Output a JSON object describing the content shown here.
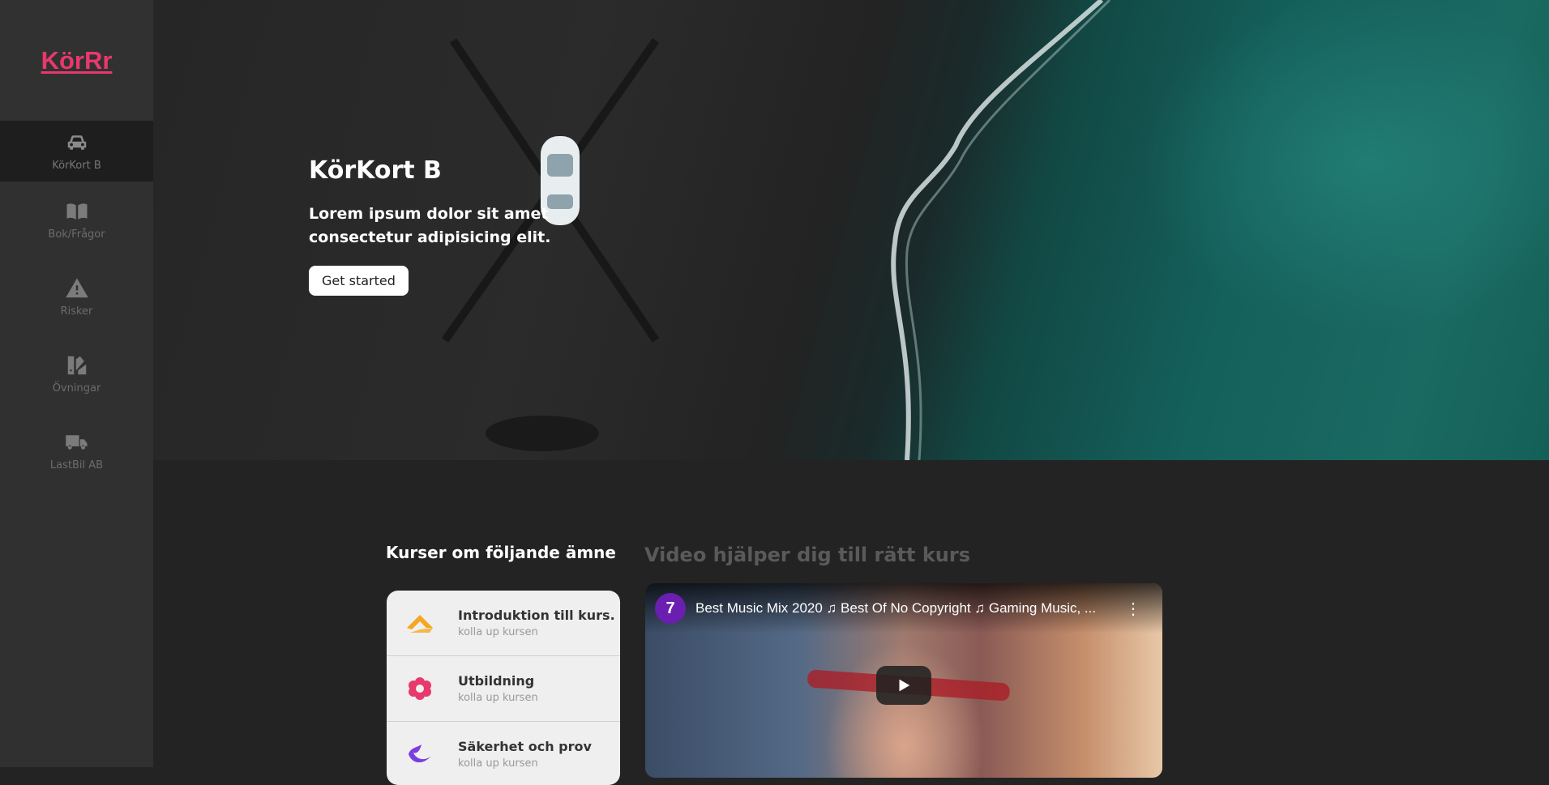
{
  "brand": "KörRr",
  "nav": [
    {
      "label": "KörKort B",
      "icon": "car-icon"
    },
    {
      "label": "Bok/Frågor",
      "icon": "book-icon"
    },
    {
      "label": "Risker",
      "icon": "warning-icon"
    },
    {
      "label": "Övningar",
      "icon": "swatches-icon"
    },
    {
      "label": "LastBil AB",
      "icon": "truck-icon"
    }
  ],
  "hero": {
    "title": "KörKort B",
    "subtitle": "Lorem ipsum dolor sit amet consectetur adipisicing elit.",
    "button": "Get started"
  },
  "courses": {
    "title": "Kurser om följande ämne",
    "items": [
      {
        "title": "Introduktion till kurs.",
        "sub": "kolla up kursen",
        "icon": "layers-icon",
        "color": "#f5a623"
      },
      {
        "title": "Utbildning",
        "sub": "kolla up kursen",
        "icon": "flower-icon",
        "color": "#e8386d"
      },
      {
        "title": "Säkerhet och prov",
        "sub": "kolla up kursen",
        "icon": "wave-icon",
        "color": "#7a3ee0"
      }
    ]
  },
  "video": {
    "section_title": "Video hjälper dig till rätt kurs",
    "title": "Best Music Mix 2020 ♫ Best Of No Copyright ♫ Gaming Music, ...",
    "channel_initial": "7",
    "menu": "⋮"
  },
  "colors": {
    "brand": "#e8386d",
    "sidebar": "#303030",
    "background": "#232323"
  }
}
